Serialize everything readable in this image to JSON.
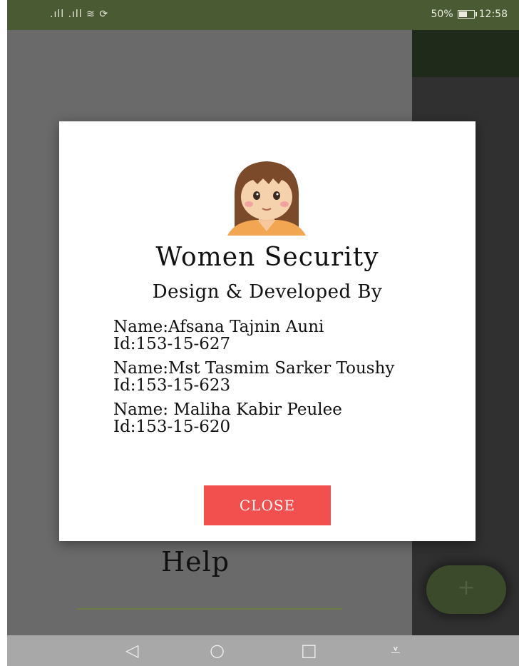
{
  "status_bar": {
    "signal_text": ".ıll  .ıll  ≋  ⟳",
    "battery_text": "50%",
    "time": "12:58"
  },
  "background": {
    "help_label": "Help"
  },
  "dialog": {
    "title": "Women Security",
    "subtitle": "Design & Developed By",
    "developers": [
      {
        "name": "Name:Afsana Tajnin Auni",
        "id": "Id:153-15-627"
      },
      {
        "name": "Name:Mst Tasmim Sarker Toushy",
        "id": "Id:153-15-623"
      },
      {
        "name": "Name: Maliha Kabir Peulee",
        "id": "Id:153-15-620"
      }
    ],
    "close_label": "CLOSE"
  },
  "fab": {
    "icon": "+"
  },
  "nav_bar": {
    "back": "◁",
    "home": "○",
    "recent": "□",
    "notifications": "⩡"
  },
  "colors": {
    "status_bar": "#4a5a33",
    "close_button": "#f24f4f",
    "fab": "#3a4a2a"
  }
}
